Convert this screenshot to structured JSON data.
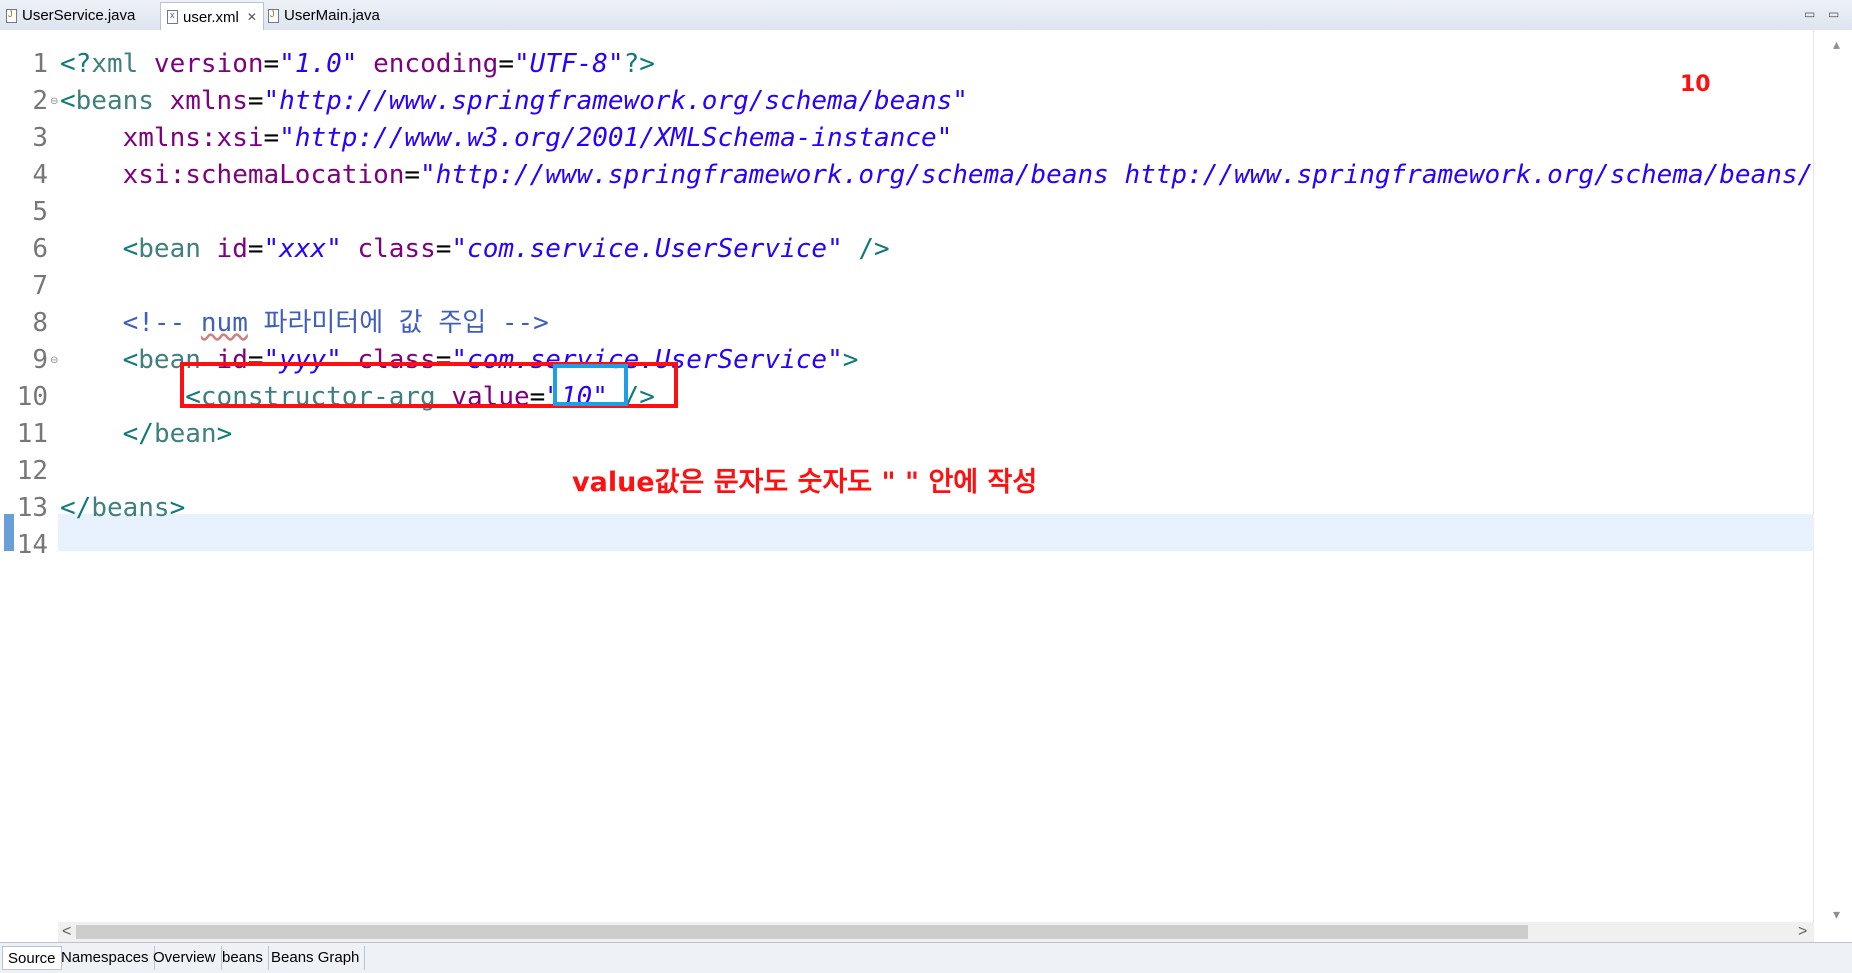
{
  "tabs": [
    {
      "label": "UserService.java",
      "icon": "java-file-icon",
      "active": false
    },
    {
      "label": "user.xml",
      "icon": "xml-file-icon",
      "active": true,
      "close": "✕"
    },
    {
      "label": "UserMain.java",
      "icon": "java-file-icon",
      "active": false
    }
  ],
  "window_controls": {
    "minimize": "▭",
    "maximize": "▭"
  },
  "line_numbers": [
    "1",
    "2",
    "3",
    "4",
    "5",
    "6",
    "7",
    "8",
    "9",
    "10",
    "11",
    "12",
    "13",
    "14"
  ],
  "code": {
    "l1": {
      "open": "<?",
      "name": "xml",
      "a1": " version",
      "v1": "\"1.0\"",
      "a2": " encoding",
      "v2": "\"UTF-8\"",
      "close": "?>"
    },
    "l2": {
      "open": "<",
      "name": "beans",
      "a1": " xmlns",
      "v1": "\"http://www.springframework.org/schema/beans\""
    },
    "l3": {
      "a1": "xmlns:xsi",
      "v1": "\"http://www.w3.org/2001/XMLSchema-instance\""
    },
    "l4": {
      "a1": "xsi:schemaLocation",
      "v1": "\"http://www.springframework.org/schema/beans http://www.springframework.org/schema/beans/spring-beans.xsd\"",
      "close": ">"
    },
    "l6": {
      "open": "<",
      "name": "bean",
      "a1": " id",
      "v1": "\"xxx\"",
      "a2": " class",
      "v2": "\"com.service.UserService\"",
      "close": " />"
    },
    "l8": {
      "c1": "<!-- ",
      "c2": "num",
      "c3": " 파라미터에 값 주입 -->"
    },
    "l9": {
      "open": "<",
      "name": "bean",
      "a1": " id",
      "v1": "\"yyy\"",
      "a2": " class",
      "v2": "\"com.service.UserService\"",
      "close": ">"
    },
    "l10": {
      "open": "<",
      "name": "constructor-arg",
      "a1": " value",
      "v1": "\"10\"",
      "close": " />"
    },
    "l11": {
      "open": "</",
      "name": "bean",
      "close": ">"
    },
    "l13": {
      "open": "</",
      "name": "beans",
      "close": ">"
    }
  },
  "annotations": {
    "note": "value값은 문자도 숫자도 \" \" 안에 작성",
    "corner": "10",
    "highlight_color": "#ff1010",
    "value_box_color": "#1ea0e6"
  },
  "bottom_tabs": [
    "Source",
    "Namespaces",
    "Overview",
    "beans",
    "Beans Graph"
  ],
  "scroll": {
    "left_arrow": "<",
    "right_arrow": ">",
    "up_arrow": "▴",
    "down_arrow": "▾"
  }
}
